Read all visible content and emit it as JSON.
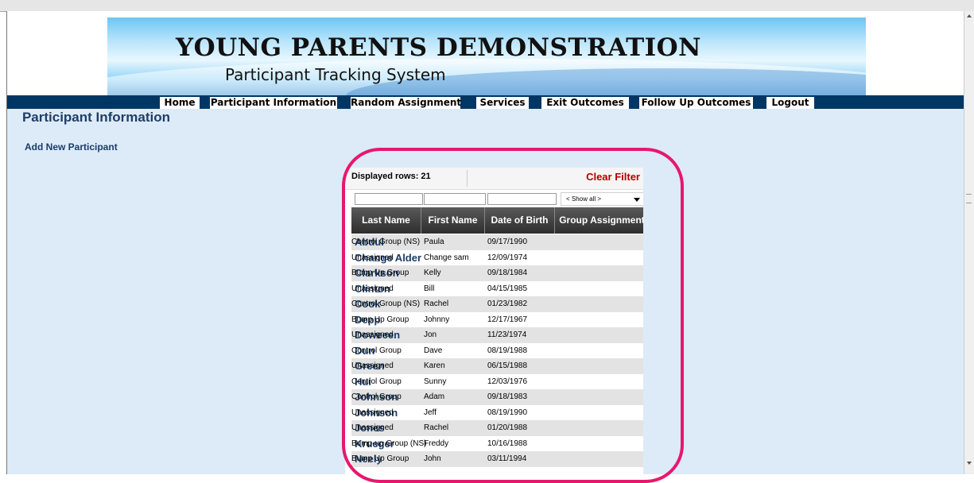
{
  "banner": {
    "title": "YOUNG PARENTS DEMONSTRATION",
    "subtitle": "Participant Tracking System"
  },
  "nav": {
    "items": [
      "Home",
      "Participant Information",
      "Random Assignment",
      "Services",
      "Exit Outcomes",
      "Follow Up Outcomes",
      "Logout"
    ]
  },
  "page": {
    "heading": "Participant Information",
    "add_link": "Add New Participant"
  },
  "table": {
    "displayed_rows": "Displayed rows: 21",
    "clear_filter": "Clear Filter",
    "group_filter_value": "< Show all >",
    "columns": [
      "Last Name",
      "First Name",
      "Date of Birth",
      "Group Assignment"
    ],
    "rows": [
      {
        "last": "Abdul",
        "first": "Paula",
        "dob": "09/17/1990",
        "group": "Control Group (NS)"
      },
      {
        "last": "Change Alder",
        "first": "Change sam",
        "dob": "12/09/1974",
        "group": "Unassigned"
      },
      {
        "last": "Clarkson",
        "first": "Kelly",
        "dob": "09/18/1984",
        "group": "Bump Up Group"
      },
      {
        "last": "Clinton",
        "first": "Bill",
        "dob": "04/15/1985",
        "group": "Unassigned"
      },
      {
        "last": "Cook",
        "first": "Rachel",
        "dob": "01/23/1982",
        "group": "Control Group (NS)"
      },
      {
        "last": "Depp",
        "first": "Johnny",
        "dob": "12/17/1967",
        "group": "Bump Up Group"
      },
      {
        "last": "Doweeen",
        "first": "Jon",
        "dob": "11/23/1974",
        "group": "Unassigned"
      },
      {
        "last": "Dun",
        "first": "Dave",
        "dob": "08/19/1988",
        "group": "Control Group"
      },
      {
        "last": "Green",
        "first": "Karen",
        "dob": "06/15/1988",
        "group": "Unassigned"
      },
      {
        "last": "Hui",
        "first": "Sunny",
        "dob": "12/03/1976",
        "group": "Control Group"
      },
      {
        "last": "Johnson",
        "first": "Adam",
        "dob": "09/18/1983",
        "group": "Control Group"
      },
      {
        "last": "Johnson",
        "first": "Jeff",
        "dob": "08/19/1990",
        "group": "Unassigned"
      },
      {
        "last": "Jones",
        "first": "Rachel",
        "dob": "01/20/1988",
        "group": "Unassigned"
      },
      {
        "last": "Krueger",
        "first": "Freddy",
        "dob": "10/16/1988",
        "group": "Bump-up Group (NS)"
      },
      {
        "last": "Neely",
        "first": "John",
        "dob": "03/11/1994",
        "group": "Bump Up Group"
      }
    ]
  },
  "colors": {
    "nav_bar": "#003663",
    "page_background": "#dcebf7",
    "highlight_ring": "#e8176e",
    "link_text": "#1a3c68",
    "clear_filter": "#b40000"
  }
}
